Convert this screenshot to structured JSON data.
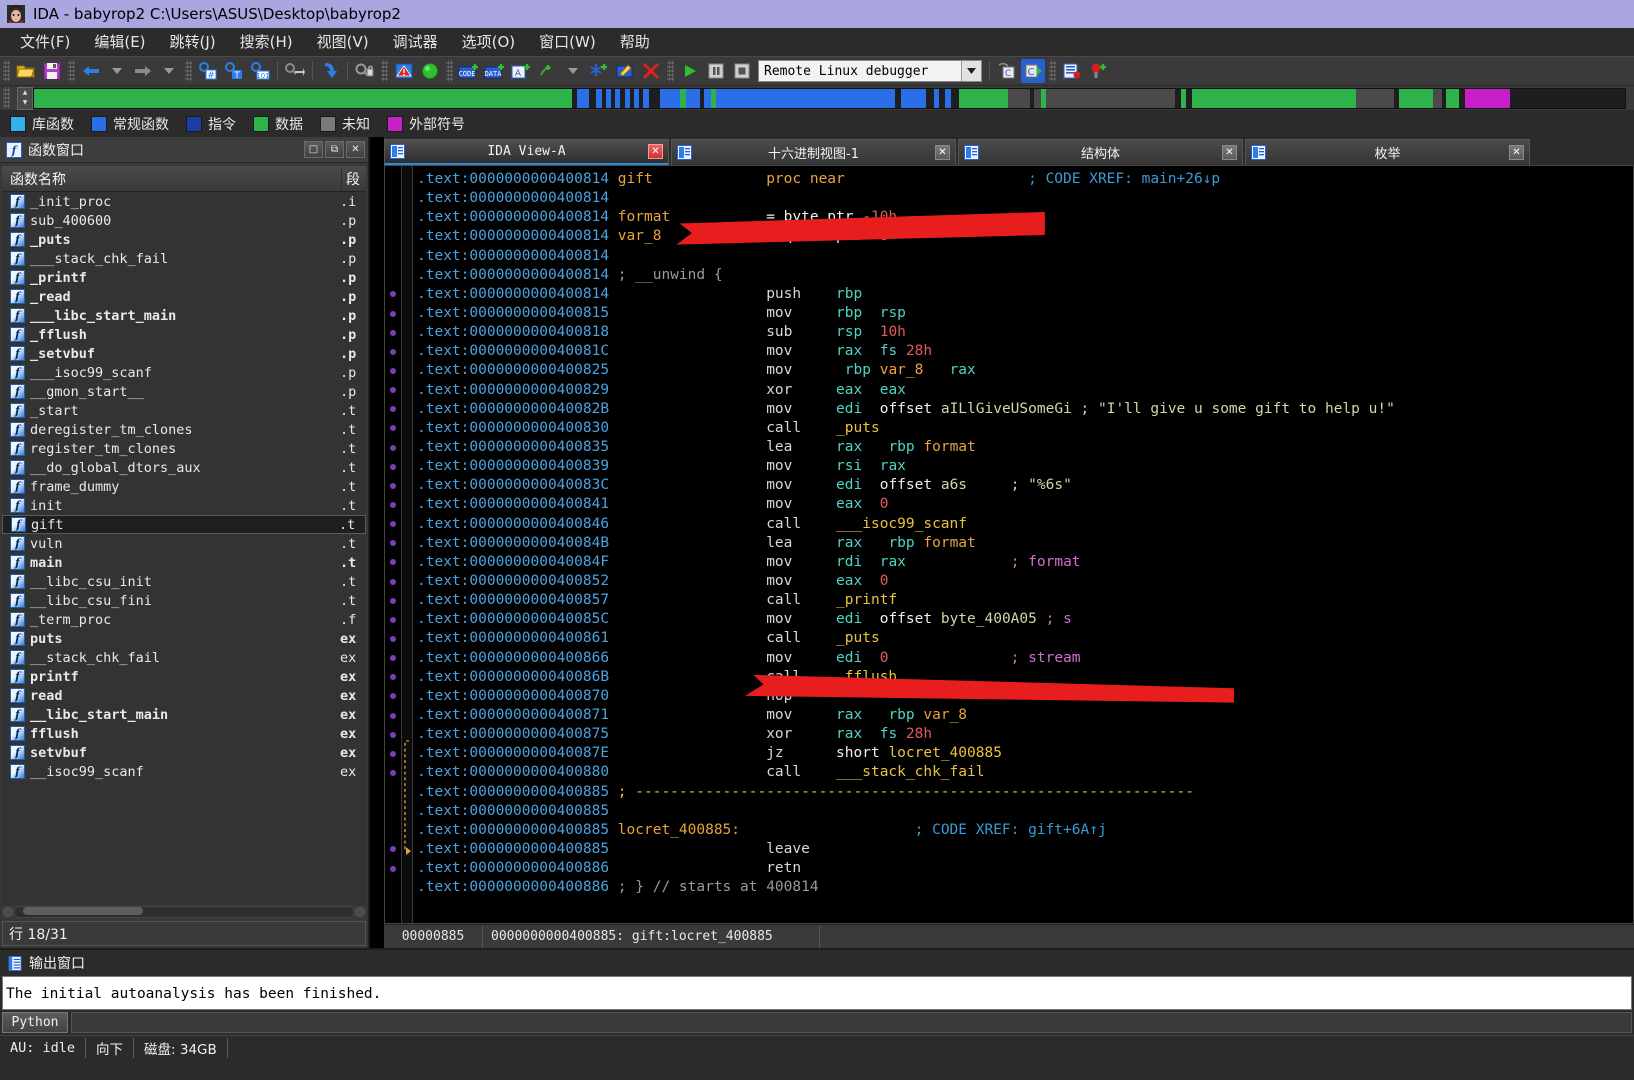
{
  "window": {
    "title": "IDA - babyrop2 C:\\Users\\ASUS\\Desktop\\babyrop2",
    "icon": "ida-logo-icon"
  },
  "menu": [
    {
      "label": "文件(F)",
      "name": "menu-file"
    },
    {
      "label": "编辑(E)",
      "name": "menu-edit"
    },
    {
      "label": "跳转(J)",
      "name": "menu-jump"
    },
    {
      "label": "搜索(H)",
      "name": "menu-search"
    },
    {
      "label": "视图(V)",
      "name": "menu-view"
    },
    {
      "label": "调试器",
      "name": "menu-debugger"
    },
    {
      "label": "选项(O)",
      "name": "menu-options"
    },
    {
      "label": "窗口(W)",
      "name": "menu-window"
    },
    {
      "label": "帮助",
      "name": "menu-help"
    }
  ],
  "toolbar": {
    "debugger_select": "Remote Linux debugger",
    "icons": [
      "open-file-icon",
      "save-icon",
      "back-arrow-icon",
      "back-dropdown-icon",
      "forward-arrow-icon",
      "forward-dropdown-icon",
      "search-hex-icon",
      "search-text-icon",
      "search-binary-icon",
      "jump-icon",
      "jump-down-icon",
      "lock-icon",
      "warning-icon",
      "green-circle-icon",
      "make-code-icon",
      "make-data-icon",
      "make-ascii-icon",
      "make-struct-icon",
      "struct-dropdown-icon",
      "make-array-icon",
      "edit-icon",
      "delete-icon",
      "run-icon",
      "pause-icon",
      "stop-icon",
      "step-over-icon",
      "step-into-icon",
      "breakpoint-list-icon",
      "add-breakpoint-icon"
    ]
  },
  "navband": {
    "segments": [
      {
        "color": "#2eb34a",
        "width": 37.5
      },
      {
        "color": "#1e1e1e",
        "width": 0.4
      },
      {
        "color": "#2a6fe8",
        "width": 0.8
      },
      {
        "color": "#1e1e1e",
        "width": 0.5
      },
      {
        "color": "#2a6fe8",
        "width": 0.4
      },
      {
        "color": "#1e1e1e",
        "width": 0.3
      },
      {
        "color": "#2a6fe8",
        "width": 0.35
      },
      {
        "color": "#1e1e1e",
        "width": 0.3
      },
      {
        "color": "#2a6fe8",
        "width": 0.35
      },
      {
        "color": "#1e1e1e",
        "width": 0.3
      },
      {
        "color": "#2a6fe8",
        "width": 0.35
      },
      {
        "color": "#1e1e1e",
        "width": 0.3
      },
      {
        "color": "#2a6fe8",
        "width": 0.35
      },
      {
        "color": "#1e1e1e",
        "width": 0.3
      },
      {
        "color": "#2a6fe8",
        "width": 0.4
      },
      {
        "color": "#1e1e1e",
        "width": 0.8
      },
      {
        "color": "#2a6fe8",
        "width": 1.4
      },
      {
        "color": "#2eb34a",
        "width": 0.35
      },
      {
        "color": "#2a6fe8",
        "width": 1.0
      },
      {
        "color": "#1e1e1e",
        "width": 0.3
      },
      {
        "color": "#2a6fe8",
        "width": 0.5
      },
      {
        "color": "#2eb34a",
        "width": 0.3
      },
      {
        "color": "#2a6fe8",
        "width": 12.5
      },
      {
        "color": "#1e1e1e",
        "width": 0.4
      },
      {
        "color": "#2a6fe8",
        "width": 1.8
      },
      {
        "color": "#1e1e1e",
        "width": 0.5
      },
      {
        "color": "#2a6fe8",
        "width": 0.4
      },
      {
        "color": "#1e1e1e",
        "width": 0.4
      },
      {
        "color": "#2a6fe8",
        "width": 0.4
      },
      {
        "color": "#1e1e1e",
        "width": 0.6
      },
      {
        "color": "#2eb34a",
        "width": 3.4
      },
      {
        "color": "#4a4a4a",
        "width": 1.5
      },
      {
        "color": "#1e1e1e",
        "width": 0.3
      },
      {
        "color": "#4a4a4a",
        "width": 0.5
      },
      {
        "color": "#2eb34a",
        "width": 0.35
      },
      {
        "color": "#4a4a4a",
        "width": 9.0
      },
      {
        "color": "#1e1e1e",
        "width": 0.4
      },
      {
        "color": "#2eb34a",
        "width": 0.35
      },
      {
        "color": "#1e1e1e",
        "width": 0.4
      },
      {
        "color": "#2eb34a",
        "width": 11.5
      },
      {
        "color": "#4a4a4a",
        "width": 2.6
      },
      {
        "color": "#1e1e1e",
        "width": 0.35
      },
      {
        "color": "#2eb34a",
        "width": 2.4
      },
      {
        "color": "#4a4a4a",
        "width": 0.6
      },
      {
        "color": "#1e1e1e",
        "width": 0.3
      },
      {
        "color": "#2eb34a",
        "width": 0.9
      },
      {
        "color": "#1e1e1e",
        "width": 0.4
      },
      {
        "color": "#c81fc8",
        "width": 3.2
      },
      {
        "color": "#1e1e1e",
        "width": 8.0
      }
    ]
  },
  "legend": [
    {
      "label": "库函数",
      "color": "#35b0ef",
      "name": "legend-library-function"
    },
    {
      "label": "常规函数",
      "color": "#2a6fe8",
      "name": "legend-regular-function"
    },
    {
      "label": "指令",
      "color": "#1b3fa0",
      "name": "legend-instruction"
    },
    {
      "label": "数据",
      "color": "#2eb34a",
      "name": "legend-data"
    },
    {
      "label": "未知",
      "color": "#7a7a7a",
      "name": "legend-unknown"
    },
    {
      "label": "外部符号",
      "color": "#c81fc8",
      "name": "legend-external-symbol"
    }
  ],
  "functions_panel": {
    "title": "函数窗口",
    "window_buttons": [
      "□",
      "⧉",
      "✕"
    ],
    "columns": {
      "name": "函数名称",
      "segment": "段"
    },
    "status": "行 18/31",
    "rows": [
      {
        "name": "_init_proc",
        "segment": ".i",
        "bold": false,
        "selected": false
      },
      {
        "name": "sub_400600",
        "segment": ".p",
        "bold": false,
        "selected": false
      },
      {
        "name": "_puts",
        "segment": ".p",
        "bold": true,
        "selected": false
      },
      {
        "name": "___stack_chk_fail",
        "segment": ".p",
        "bold": false,
        "selected": false
      },
      {
        "name": "_printf",
        "segment": ".p",
        "bold": true,
        "selected": false
      },
      {
        "name": "_read",
        "segment": ".p",
        "bold": true,
        "selected": false
      },
      {
        "name": "___libc_start_main",
        "segment": ".p",
        "bold": true,
        "selected": false
      },
      {
        "name": "_fflush",
        "segment": ".p",
        "bold": true,
        "selected": false
      },
      {
        "name": "_setvbuf",
        "segment": ".p",
        "bold": true,
        "selected": false
      },
      {
        "name": "___isoc99_scanf",
        "segment": ".p",
        "bold": false,
        "selected": false
      },
      {
        "name": "__gmon_start__",
        "segment": ".p",
        "bold": false,
        "selected": false
      },
      {
        "name": "_start",
        "segment": ".t",
        "bold": false,
        "selected": false
      },
      {
        "name": "deregister_tm_clones",
        "segment": ".t",
        "bold": false,
        "selected": false
      },
      {
        "name": "register_tm_clones",
        "segment": ".t",
        "bold": false,
        "selected": false
      },
      {
        "name": "__do_global_dtors_aux",
        "segment": ".t",
        "bold": false,
        "selected": false
      },
      {
        "name": "frame_dummy",
        "segment": ".t",
        "bold": false,
        "selected": false
      },
      {
        "name": "init",
        "segment": ".t",
        "bold": false,
        "selected": false
      },
      {
        "name": "gift",
        "segment": ".t",
        "bold": false,
        "selected": true
      },
      {
        "name": "vuln",
        "segment": ".t",
        "bold": false,
        "selected": false
      },
      {
        "name": "main",
        "segment": ".t",
        "bold": true,
        "selected": false
      },
      {
        "name": "__libc_csu_init",
        "segment": ".t",
        "bold": false,
        "selected": false
      },
      {
        "name": "__libc_csu_fini",
        "segment": ".t",
        "bold": false,
        "selected": false
      },
      {
        "name": "_term_proc",
        "segment": ".f",
        "bold": false,
        "selected": false
      },
      {
        "name": "puts",
        "segment": "ex",
        "bold": true,
        "selected": false
      },
      {
        "name": "__stack_chk_fail",
        "segment": "ex",
        "bold": false,
        "selected": false
      },
      {
        "name": "printf",
        "segment": "ex",
        "bold": true,
        "selected": false
      },
      {
        "name": "read",
        "segment": "ex",
        "bold": true,
        "selected": false
      },
      {
        "name": "__libc_start_main",
        "segment": "ex",
        "bold": true,
        "selected": false
      },
      {
        "name": "fflush",
        "segment": "ex",
        "bold": true,
        "selected": false
      },
      {
        "name": "setvbuf",
        "segment": "ex",
        "bold": true,
        "selected": false
      },
      {
        "name": "__isoc99_scanf",
        "segment": "ex",
        "bold": false,
        "selected": false
      }
    ]
  },
  "tabs": [
    {
      "label": "IDA View-A",
      "icon": "ida-view-icon",
      "active": true,
      "close": "✕",
      "mono": true
    },
    {
      "label": "十六进制视图-1",
      "icon": "hex-view-icon",
      "active": false,
      "close": "✕",
      "mono": false
    },
    {
      "label": "结构体",
      "icon": "structures-icon",
      "active": false,
      "close": "✕",
      "mono": false
    },
    {
      "label": "枚举",
      "icon": "enums-icon",
      "active": false,
      "close": "✕",
      "mono": false
    }
  ],
  "disassembly": {
    "lines": [
      {
        "addr": ".text:0000000000400814",
        "label": "gift",
        "mnem": "",
        "ops": "proc near",
        "cmt": "; CODE XREF: main+26↓p",
        "bp": false,
        "kind": "proc"
      },
      {
        "addr": ".text:0000000000400814",
        "label": "",
        "mnem": "",
        "ops": "",
        "cmt": "",
        "bp": false,
        "kind": "blank"
      },
      {
        "addr": ".text:0000000000400814",
        "label": "format",
        "mnem": "",
        "ops": "= byte ptr -10h",
        "cmt": "",
        "bp": false,
        "kind": "var"
      },
      {
        "addr": ".text:0000000000400814",
        "label": "var_8",
        "mnem": "",
        "ops": "= qword ptr -8",
        "cmt": "",
        "bp": false,
        "kind": "var"
      },
      {
        "addr": ".text:0000000000400814",
        "label": "",
        "mnem": "",
        "ops": "",
        "cmt": "",
        "bp": false,
        "kind": "blank"
      },
      {
        "addr": ".text:0000000000400814",
        "label": "",
        "mnem": "",
        "ops": "",
        "cmt": "; __unwind {",
        "bp": false,
        "kind": "unwind"
      },
      {
        "addr": ".text:0000000000400814",
        "label": "",
        "mnem": "push",
        "ops": "rbp",
        "cmt": "",
        "bp": true,
        "kind": "ins"
      },
      {
        "addr": ".text:0000000000400815",
        "label": "",
        "mnem": "mov",
        "ops": "rbp, rsp",
        "cmt": "",
        "bp": true,
        "kind": "ins"
      },
      {
        "addr": ".text:0000000000400818",
        "label": "",
        "mnem": "sub",
        "ops": "rsp, 10h",
        "cmt": "",
        "bp": true,
        "kind": "ins"
      },
      {
        "addr": ".text:000000000040081C",
        "label": "",
        "mnem": "mov",
        "ops": "rax, fs:28h",
        "cmt": "",
        "bp": true,
        "kind": "ins"
      },
      {
        "addr": ".text:0000000000400825",
        "label": "",
        "mnem": "mov",
        "ops": "[rbp+var_8], rax",
        "cmt": "",
        "bp": true,
        "kind": "ins"
      },
      {
        "addr": ".text:0000000000400829",
        "label": "",
        "mnem": "xor",
        "ops": "eax, eax",
        "cmt": "",
        "bp": true,
        "kind": "ins"
      },
      {
        "addr": ".text:000000000040082B",
        "label": "",
        "mnem": "mov",
        "ops": "edi, offset aILlGiveUSomeGi",
        "cmt": "; \"I'll give u some gift to help u!\"",
        "bp": true,
        "kind": "ins"
      },
      {
        "addr": ".text:0000000000400830",
        "label": "",
        "mnem": "call",
        "ops": "_puts",
        "cmt": "",
        "bp": true,
        "kind": "call"
      },
      {
        "addr": ".text:0000000000400835",
        "label": "",
        "mnem": "lea",
        "ops": "rax, [rbp+format]",
        "cmt": "",
        "bp": true,
        "kind": "ins"
      },
      {
        "addr": ".text:0000000000400839",
        "label": "",
        "mnem": "mov",
        "ops": "rsi, rax",
        "cmt": "",
        "bp": true,
        "kind": "ins"
      },
      {
        "addr": ".text:000000000040083C",
        "label": "",
        "mnem": "mov",
        "ops": "edi, offset a6s",
        "cmt": "; \"%6s\"",
        "bp": true,
        "kind": "ins"
      },
      {
        "addr": ".text:0000000000400841",
        "label": "",
        "mnem": "mov",
        "ops": "eax, 0",
        "cmt": "",
        "bp": true,
        "kind": "ins"
      },
      {
        "addr": ".text:0000000000400846",
        "label": "",
        "mnem": "call",
        "ops": "___isoc99_scanf",
        "cmt": "",
        "bp": true,
        "kind": "call"
      },
      {
        "addr": ".text:000000000040084B",
        "label": "",
        "mnem": "lea",
        "ops": "rax, [rbp+format]",
        "cmt": "",
        "bp": true,
        "kind": "ins"
      },
      {
        "addr": ".text:000000000040084F",
        "label": "",
        "mnem": "mov",
        "ops": "rdi, rax",
        "cmt": "; format",
        "bp": true,
        "kind": "ins"
      },
      {
        "addr": ".text:0000000000400852",
        "label": "",
        "mnem": "mov",
        "ops": "eax, 0",
        "cmt": "",
        "bp": true,
        "kind": "ins"
      },
      {
        "addr": ".text:0000000000400857",
        "label": "",
        "mnem": "call",
        "ops": "_printf",
        "cmt": "",
        "bp": true,
        "kind": "call"
      },
      {
        "addr": ".text:000000000040085C",
        "label": "",
        "mnem": "mov",
        "ops": "edi, offset byte_400A05",
        "cmt": "; s",
        "bp": true,
        "kind": "ins"
      },
      {
        "addr": ".text:0000000000400861",
        "label": "",
        "mnem": "call",
        "ops": "_puts",
        "cmt": "",
        "bp": true,
        "kind": "call"
      },
      {
        "addr": ".text:0000000000400866",
        "label": "",
        "mnem": "mov",
        "ops": "edi, 0",
        "cmt": "; stream",
        "bp": true,
        "kind": "ins"
      },
      {
        "addr": ".text:000000000040086B",
        "label": "",
        "mnem": "call",
        "ops": "_fflush",
        "cmt": "",
        "bp": true,
        "kind": "call"
      },
      {
        "addr": ".text:0000000000400870",
        "label": "",
        "mnem": "nop",
        "ops": "",
        "cmt": "",
        "bp": true,
        "kind": "ins"
      },
      {
        "addr": ".text:0000000000400871",
        "label": "",
        "mnem": "mov",
        "ops": "rax, [rbp+var_8]",
        "cmt": "",
        "bp": true,
        "kind": "ins"
      },
      {
        "addr": ".text:0000000000400875",
        "label": "",
        "mnem": "xor",
        "ops": "rax, fs:28h",
        "cmt": "",
        "bp": true,
        "kind": "ins"
      },
      {
        "addr": ".text:000000000040087E",
        "label": "",
        "mnem": "jz",
        "ops": "short locret_400885",
        "cmt": "",
        "bp": true,
        "kind": "jmp"
      },
      {
        "addr": ".text:0000000000400880",
        "label": "",
        "mnem": "call",
        "ops": "___stack_chk_fail",
        "cmt": "",
        "bp": true,
        "kind": "call"
      },
      {
        "addr": ".text:0000000000400885",
        "label": "",
        "mnem": "",
        "ops": "",
        "cmt": "; ----------------------------------------------------------------",
        "bp": false,
        "kind": "rule"
      },
      {
        "addr": ".text:0000000000400885",
        "label": "",
        "mnem": "",
        "ops": "",
        "cmt": "",
        "bp": false,
        "kind": "blank"
      },
      {
        "addr": ".text:0000000000400885",
        "label": "locret_400885:",
        "mnem": "",
        "ops": "",
        "cmt": "; CODE XREF: gift+6A↑j",
        "bp": false,
        "kind": "lbl"
      },
      {
        "addr": ".text:0000000000400885",
        "label": "",
        "mnem": "leave",
        "ops": "",
        "cmt": "",
        "bp": true,
        "kind": "ins"
      },
      {
        "addr": ".text:0000000000400886",
        "label": "",
        "mnem": "retn",
        "ops": "",
        "cmt": "",
        "bp": true,
        "kind": "ins"
      },
      {
        "addr": ".text:0000000000400886",
        "label": "",
        "mnem": "",
        "ops": "",
        "cmt": "; } // starts at 400814",
        "bp": false,
        "kind": "endcmt"
      }
    ],
    "status": {
      "offset": "00000885",
      "location": "0000000000400885: gift:locret_400885"
    }
  },
  "output_window": {
    "title": "输出窗口",
    "lines": [
      "The initial autoanalysis has been finished."
    ],
    "python_button": "Python",
    "python_input": ""
  },
  "status_bar": [
    {
      "label": "AU: idle",
      "name": "status-autoanalysis"
    },
    {
      "label": "向下",
      "name": "status-direction",
      "cjk": true
    },
    {
      "label": "磁盘: 34GB",
      "name": "status-disk",
      "cjk": true
    }
  ]
}
